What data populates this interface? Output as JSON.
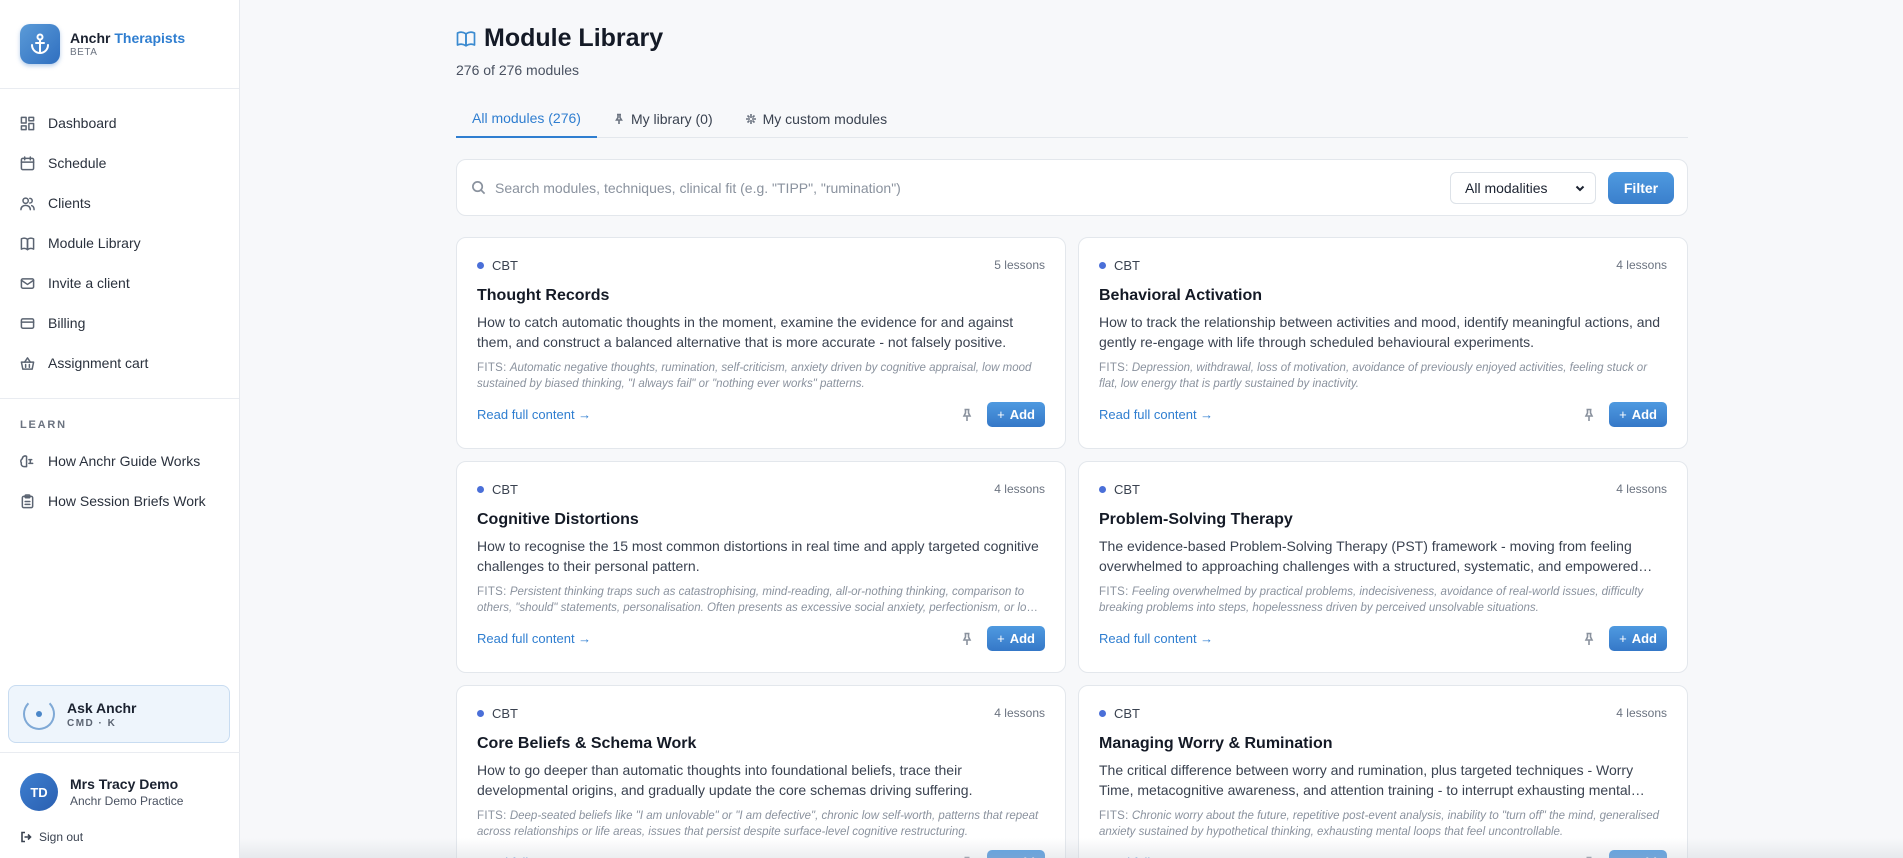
{
  "brand": {
    "name": "Anchr",
    "accent": "Therapists",
    "badge": "BETA",
    "icon": "anchor-icon"
  },
  "nav": [
    {
      "label": "Dashboard",
      "icon": "dashboard-icon"
    },
    {
      "label": "Schedule",
      "icon": "calendar-icon"
    },
    {
      "label": "Clients",
      "icon": "users-icon"
    },
    {
      "label": "Module Library",
      "icon": "book-icon"
    },
    {
      "label": "Invite a client",
      "icon": "mail-icon"
    },
    {
      "label": "Billing",
      "icon": "credit-card-icon"
    },
    {
      "label": "Assignment cart",
      "icon": "basket-icon"
    }
  ],
  "learn": {
    "heading": "LEARN",
    "items": [
      {
        "label": "How Anchr Guide Works",
        "icon": "brain-icon"
      },
      {
        "label": "How Session Briefs Work",
        "icon": "clipboard-icon"
      }
    ]
  },
  "ask": {
    "title": "Ask Anchr",
    "shortcut": "CMD · K"
  },
  "user": {
    "initials": "TD",
    "name": "Mrs Tracy Demo",
    "practice": "Anchr Demo Practice"
  },
  "signout": "Sign out",
  "page": {
    "title": "Module Library",
    "subtitle": "276 of 276 modules",
    "icon": "book-open-icon"
  },
  "tabs": [
    {
      "label": "All modules (276)",
      "active": true
    },
    {
      "label": "My library (0)",
      "icon": "pin-icon"
    },
    {
      "label": "My custom modules",
      "icon": "sparkle-icon"
    }
  ],
  "search": {
    "placeholder": "Search modules, techniques, clinical fit (e.g. \"TIPP\", \"rumination\")",
    "value": ""
  },
  "modality_select": {
    "selected": "All modalities"
  },
  "filter_label": "Filter",
  "card_labels": {
    "fits": "FITS:",
    "read": "Read full content →",
    "add": "Add",
    "add_symbol": "+"
  },
  "modules": [
    {
      "modality": "CBT",
      "lessons": "5 lessons",
      "title": "Thought Records",
      "description": "How to catch automatic thoughts in the moment, examine the evidence for and against them, and construct a balanced alternative that is more accurate - not falsely positive.",
      "fits": "Automatic negative thoughts, rumination, self-criticism, anxiety driven by cognitive appraisal, low mood sustained by biased thinking, \"I always fail\" or \"nothing ever works\" patterns."
    },
    {
      "modality": "CBT",
      "lessons": "4 lessons",
      "title": "Behavioral Activation",
      "description": "How to track the relationship between activities and mood, identify meaningful actions, and gently re-engage with life through scheduled behavioural experiments.",
      "fits": "Depression, withdrawal, loss of motivation, avoidance of previously enjoyed activities, feeling stuck or flat, low energy that is partly sustained by inactivity."
    },
    {
      "modality": "CBT",
      "lessons": "4 lessons",
      "title": "Cognitive Distortions",
      "description": "How to recognise the 15 most common distortions in real time and apply targeted cognitive challenges to their personal pattern.",
      "fits": "Persistent thinking traps such as catastrophising, mind-reading, all-or-nothing thinking, comparison to others, \"should\" statements, personalisation. Often presents as excessive social anxiety, perfectionism, or low self-esteem."
    },
    {
      "modality": "CBT",
      "lessons": "4 lessons",
      "title": "Problem-Solving Therapy",
      "description": "The evidence-based Problem-Solving Therapy (PST) framework - moving from feeling overwhelmed to approaching challenges with a structured, systematic, and empowered mindset.",
      "fits": "Feeling overwhelmed by practical problems, indecisiveness, avoidance of real-world issues, difficulty breaking problems into steps, hopelessness driven by perceived unsolvable situations."
    },
    {
      "modality": "CBT",
      "lessons": "4 lessons",
      "title": "Core Beliefs & Schema Work",
      "description": "How to go deeper than automatic thoughts into foundational beliefs, trace their developmental origins, and gradually update the core schemas driving suffering.",
      "fits": "Deep-seated beliefs like \"I am unlovable\" or \"I am defective\", chronic low self-worth, patterns that repeat across relationships or life areas, issues that persist despite surface-level cognitive restructuring."
    },
    {
      "modality": "CBT",
      "lessons": "4 lessons",
      "title": "Managing Worry & Rumination",
      "description": "The critical difference between worry and rumination, plus targeted techniques - Worry Time, metacognitive awareness, and attention training - to interrupt exhausting mental loops.",
      "fits": "Chronic worry about the future, repetitive post-event analysis, inability to \"turn off\" the mind, generalised anxiety sustained by hypothetical thinking, exhausting mental loops that feel uncontrollable."
    }
  ]
}
